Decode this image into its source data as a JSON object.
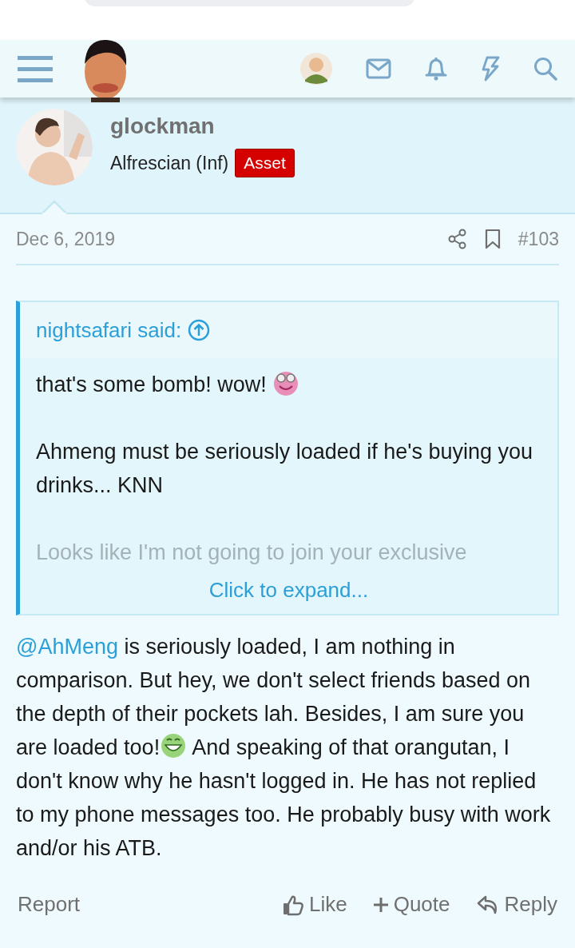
{
  "author": {
    "name": "glockman",
    "title": "Alfrescian (Inf)",
    "badge": "Asset"
  },
  "post": {
    "date": "Dec 6, 2019",
    "number": "#103"
  },
  "quote": {
    "author": "nightsafari said:",
    "paragraphs": [
      {
        "text": "that's some bomb! wow!",
        "emoji": true,
        "faded": false
      },
      {
        "text": "Ahmeng must be seriously loaded if he's buying you drinks... KNN",
        "emoji": false,
        "faded": false
      },
      {
        "text": "Looks like I'm not going to join your exclusive",
        "emoji": false,
        "faded": true
      }
    ],
    "expand": "Click to expand..."
  },
  "body": {
    "mention": "@AhMeng",
    "before_emoji": " is seriously loaded, I am nothing in comparison. But hey, we don't select friends based on the depth of their pockets lah. Besides, I am sure you are loaded too!",
    "after_emoji": " And speaking of that orangutan, I don't know why he hasn't logged in. He has not replied to my phone messages too. He probably busy with work and/or his ATB."
  },
  "actions": {
    "report": "Report",
    "buttons": [
      {
        "kind": "like",
        "label": "Like"
      },
      {
        "kind": "quote",
        "label": "Quote"
      },
      {
        "kind": "reply",
        "label": "Reply"
      }
    ]
  }
}
